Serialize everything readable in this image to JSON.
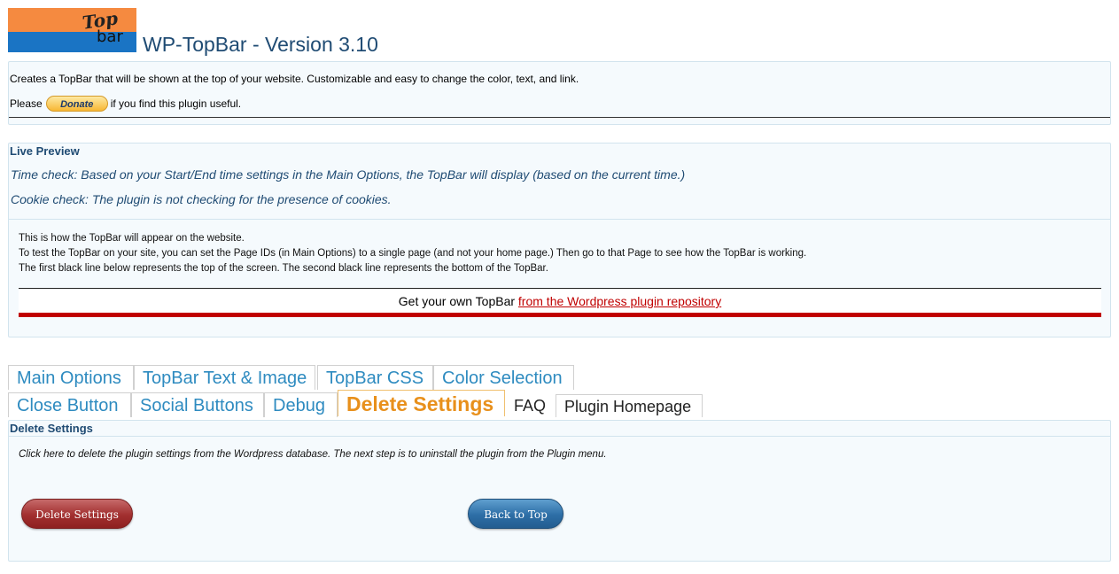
{
  "header": {
    "logo_text_top": "Top",
    "logo_text_bottom": "bar",
    "title": "WP-TopBar - Version 3.10"
  },
  "intro": {
    "description": "Creates a TopBar that will be shown at the top of your website. Customizable and easy to change the color, text, and link.",
    "please_label": "Please",
    "donate_label": "Donate",
    "useful_text": "if you find this plugin useful."
  },
  "preview": {
    "title": "Live Preview",
    "time_check": "Time check: Based on your Start/End time settings in the Main Options, the TopBar will display (based on the current time.)",
    "cookie_check": "Cookie check: The plugin is not checking for the presence of cookies.",
    "info_lines": [
      "This is how the TopBar will appear on the website.",
      "To test the TopBar on your site, you can set the Page IDs (in Main Options) to a single page (and not your home page.) Then go to that Page to see how the TopBar is working.",
      "The first black line below represents the top of the screen. The second black line represents the bottom of the TopBar."
    ],
    "topbar_text": "Get your own TopBar",
    "topbar_link": "from the Wordpress plugin repository",
    "topbar_accent": "#c00000"
  },
  "tabs": {
    "row1": [
      "Main Options",
      "TopBar Text & Image",
      "TopBar CSS",
      "Color Selection"
    ],
    "row2": [
      "Close Button",
      "Social Buttons",
      "Debug",
      "Delete Settings",
      "FAQ",
      "Plugin Homepage"
    ],
    "active": "Delete Settings"
  },
  "delete_section": {
    "title": "Delete Settings",
    "description": "Click here to delete the plugin settings from the Wordpress database. The next step is to uninstall the plugin from the Plugin menu.",
    "delete_button": "Delete Settings",
    "back_button": "Back to Top"
  }
}
